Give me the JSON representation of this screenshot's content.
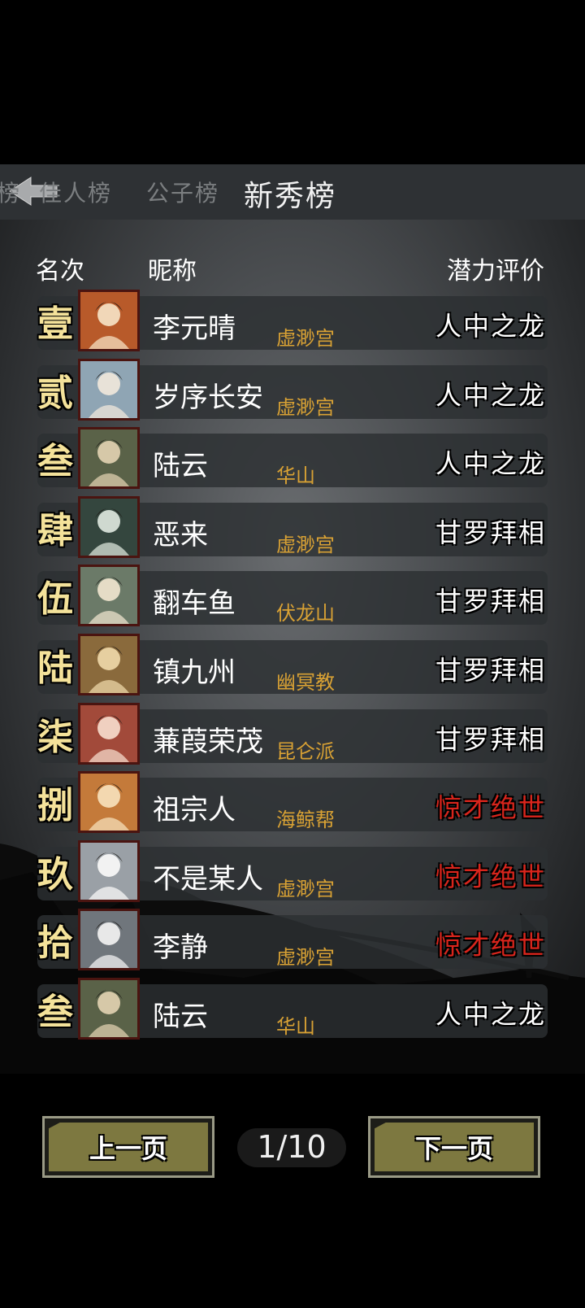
{
  "tabs": [
    {
      "label": "榜"
    },
    {
      "label": "佳人榜"
    },
    {
      "label": "公子榜"
    },
    {
      "label": "新秀榜"
    }
  ],
  "header": {
    "rank": "名次",
    "nickname": "昵称",
    "potential": "潜力评价"
  },
  "rows": [
    {
      "rank": "壹",
      "name": "李元晴",
      "sect": "虚渺宫",
      "eval": "人中之龙",
      "eval_color": "#ffffff"
    },
    {
      "rank": "贰",
      "name": "岁序长安",
      "sect": "虚渺宫",
      "eval": "人中之龙",
      "eval_color": "#ffffff"
    },
    {
      "rank": "叁",
      "name": "陆云",
      "sect": "华山",
      "eval": "人中之龙",
      "eval_color": "#ffffff"
    },
    {
      "rank": "肆",
      "name": "恶来",
      "sect": "虚渺宫",
      "eval": "甘罗拜相",
      "eval_color": "#ffffff"
    },
    {
      "rank": "伍",
      "name": "翻车鱼",
      "sect": "伏龙山",
      "eval": "甘罗拜相",
      "eval_color": "#ffffff"
    },
    {
      "rank": "陆",
      "name": "镇九州",
      "sect": "幽冥教",
      "eval": "甘罗拜相",
      "eval_color": "#ffffff"
    },
    {
      "rank": "柒",
      "name": "蒹葭荣茂",
      "sect": "昆仑派",
      "eval": "甘罗拜相",
      "eval_color": "#ffffff"
    },
    {
      "rank": "捌",
      "name": "祖宗人",
      "sect": "海鲸帮",
      "eval": "惊才绝世",
      "eval_color": "#d9251c"
    },
    {
      "rank": "玖",
      "name": "不是某人",
      "sect": "虚渺宫",
      "eval": "惊才绝世",
      "eval_color": "#d9251c"
    },
    {
      "rank": "拾",
      "name": "李静",
      "sect": "虚渺宫",
      "eval": "惊才绝世",
      "eval_color": "#d9251c"
    },
    {
      "rank": "叁",
      "name": "陆云",
      "sect": "华山",
      "eval": "人中之龙",
      "eval_color": "#ffffff"
    }
  ],
  "pagination": {
    "prev_label": "上一页",
    "page": "1/10",
    "next_label": "下一页"
  },
  "colors": {
    "accent_gold": "#f4e29a",
    "sect_text": "#d8a134",
    "button_fill": "#7d7840",
    "danger_red": "#d9251c"
  },
  "icons": {
    "back": "back-arrow-icon"
  }
}
